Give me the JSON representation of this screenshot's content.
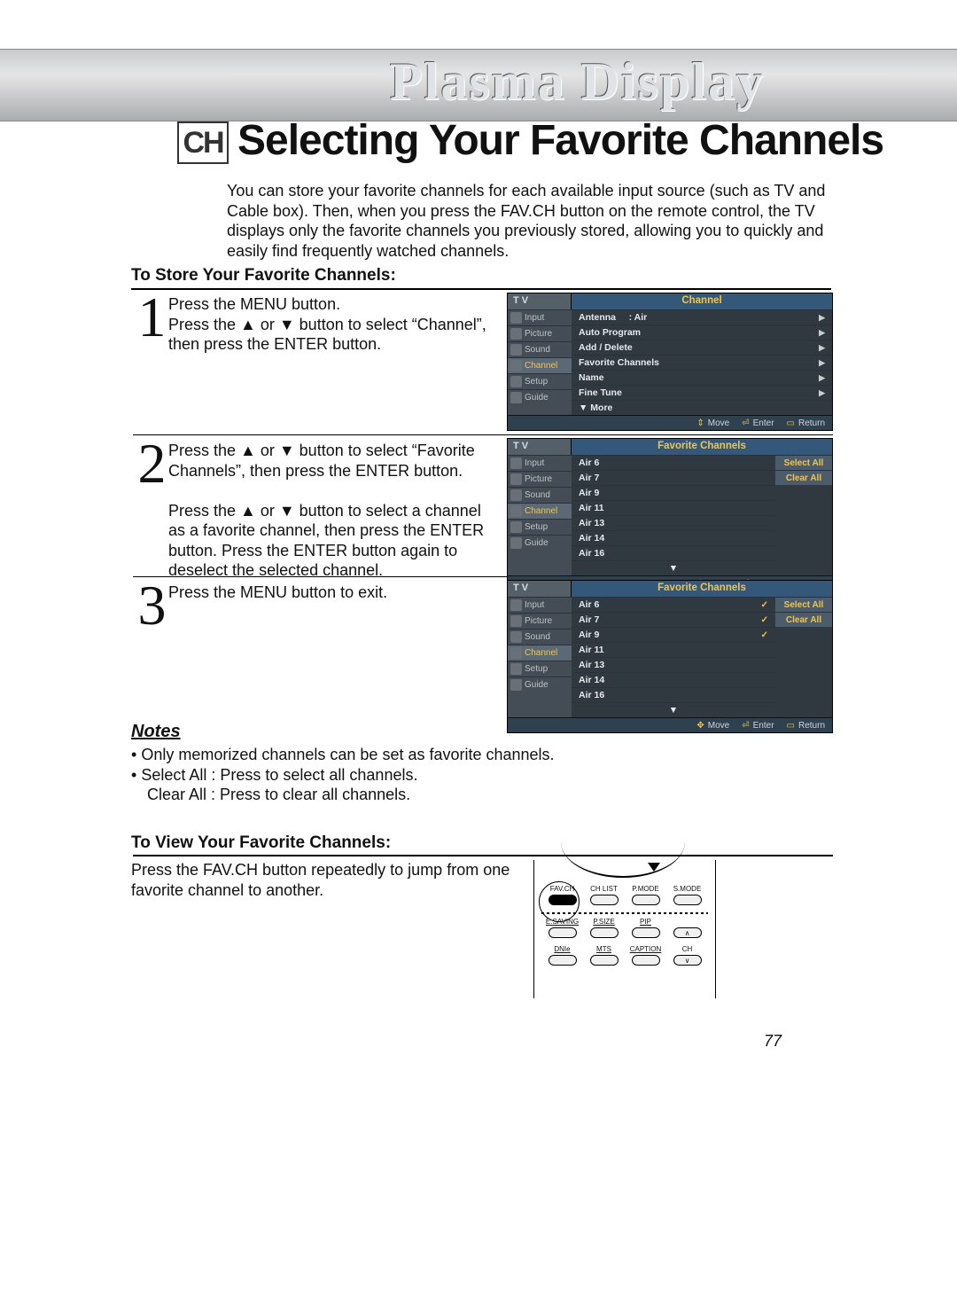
{
  "header": {
    "plasma": "Plasma Display",
    "badge": "CH",
    "title": "Selecting Your Favorite Channels"
  },
  "intro": "You can store your favorite channels for each available input source (such as TV and Cable box). Then, when you press the FAV.CH button on the remote control, the TV displays only the favorite channels you previously stored, allowing you to quickly and easily find frequently watched channels.",
  "store_heading": "To Store Your Favorite Channels:",
  "steps": [
    {
      "num": "1",
      "text": "Press the MENU button.\nPress the ▲ or ▼ button to select “Channel”, then press the ENTER button."
    },
    {
      "num": "2",
      "text": "Press the ▲ or ▼ button to select “Favorite Channels”, then press the ENTER button.\n\nPress the ▲ or ▼ button to select a channel as a favorite channel, then press the ENTER button. Press the ENTER button again to deselect the selected channel."
    },
    {
      "num": "3",
      "text": "Press the MENU button to exit."
    }
  ],
  "notes_heading": "Notes",
  "notes": [
    "Only memorized channels can be set as favorite channels.",
    "Select All : Press to select all channels.\nClear All : Press to clear all channels."
  ],
  "view_heading": "To View Your Favorite Channels:",
  "view_text": "Press the FAV.CH button repeatedly to jump from one favorite channel to another.",
  "pagenum": "77",
  "osd_common": {
    "tv": "T V",
    "sidebar": [
      "Input",
      "Picture",
      "Sound",
      "Channel",
      "Setup",
      "Guide"
    ],
    "footer": {
      "move": "Move",
      "enter": "Enter",
      "return": "Return"
    },
    "buttons": {
      "select_all": "Select All",
      "clear_all": "Clear All"
    }
  },
  "osd1": {
    "title": "Channel",
    "active": "Channel",
    "rows": [
      {
        "label": "Antenna",
        "value": ": Air",
        "arrow": true
      },
      {
        "label": "Auto Program",
        "arrow": true
      },
      {
        "label": "Add / Delete",
        "arrow": true
      },
      {
        "label": "Favorite Channels",
        "arrow": true
      },
      {
        "label": "Name",
        "arrow": true
      },
      {
        "label": "Fine Tune",
        "arrow": true
      },
      {
        "label": "▼ More"
      }
    ]
  },
  "osd2": {
    "title": "Favorite Channels",
    "active": "Channel",
    "channels": [
      "Air 6",
      "Air 7",
      "Air 9",
      "Air 11",
      "Air 13",
      "Air 14",
      "Air 16"
    ],
    "checked": []
  },
  "osd3": {
    "title": "Favorite Channels",
    "active": "Channel",
    "channels": [
      "Air 6",
      "Air 7",
      "Air 9",
      "Air 11",
      "Air 13",
      "Air 14",
      "Air 16"
    ],
    "checked": [
      0,
      1,
      2
    ]
  },
  "remote": {
    "row1": [
      "FAV.CH",
      "CH LIST",
      "P.MODE",
      "S.MODE"
    ],
    "row2": [
      "E.SAVING",
      "P.SIZE",
      "PIP",
      ""
    ],
    "row3": [
      "DNIe",
      "MTS",
      "CAPTION",
      "CH"
    ]
  }
}
